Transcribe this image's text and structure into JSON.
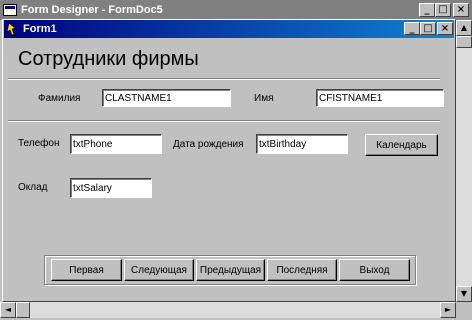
{
  "app": {
    "title": "Form Designer - FormDoc5",
    "buttons": {
      "minimize": "_",
      "maximize": "□",
      "close": "×"
    }
  },
  "child": {
    "title": "Form1",
    "buttons": {
      "minimize": "_",
      "maximize": "□",
      "close": "×"
    }
  },
  "form": {
    "heading": "Сотрудники фирмы",
    "lastname_label": "Фамилия",
    "lastname_value": "CLASTNAME1",
    "firstname_label": "Имя",
    "firstname_value": "CFISTNAME1",
    "phone_label": "Телефон",
    "phone_value": "txtPhone",
    "birthdate_label": "Дата рождения",
    "birthdate_value": "txtBirthday",
    "calendar_button": "Календарь",
    "salary_label": "Оклад",
    "salary_value": "txtSalary"
  },
  "nav": {
    "buttons": [
      "Первая",
      "Следующая",
      "Предыдущая",
      "Последняя",
      "Выход"
    ]
  },
  "scroll": {
    "up": "▲",
    "down": "▼",
    "left": "◄",
    "right": "►"
  }
}
